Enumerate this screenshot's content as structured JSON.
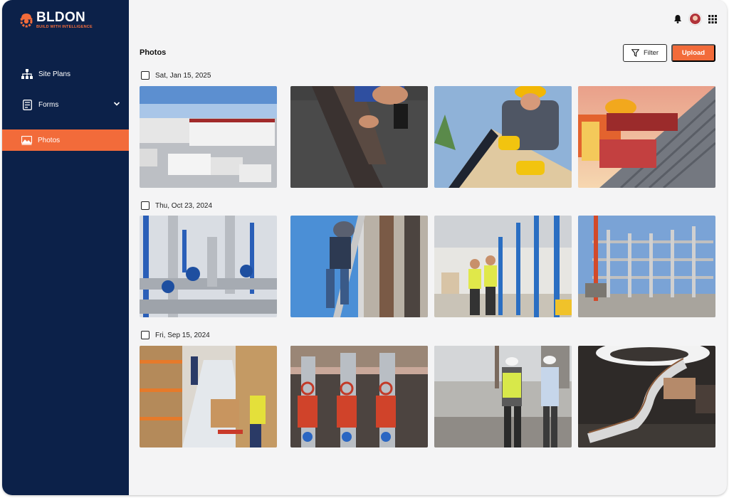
{
  "app": {
    "name": "BLDON",
    "tagline": "BUILD WITH INTELLIGENCE"
  },
  "colors": {
    "sidebar": "#0c2149",
    "accent": "#f26b3a",
    "background": "#f4f4f5"
  },
  "sidebar": {
    "items": [
      {
        "label": "Site Plans",
        "icon": "sitemap-icon"
      },
      {
        "label": "Forms",
        "icon": "form-icon"
      },
      {
        "label": "Photos",
        "icon": "photo-icon",
        "active": true
      }
    ]
  },
  "header": {
    "icons": [
      "bell-icon",
      "user-avatar",
      "grid-apps-icon"
    ]
  },
  "main": {
    "title": "Photos",
    "filter_label": "Filter",
    "upload_label": "Upload",
    "groups": [
      {
        "date": "Sat, Jan 15, 2025",
        "photos": [
          "industrial-facility",
          "floor-installation",
          "roof-carpentry",
          "roof-worker"
        ]
      },
      {
        "date": "Thu, Oct 23, 2024",
        "photos": [
          "pipe-system",
          "ladder-worker",
          "warehouse-inspection",
          "concrete-frame"
        ]
      },
      {
        "date": "Fri, Sep 15, 2024",
        "photos": [
          "warehouse-shelves",
          "valve-piping",
          "site-supervisors",
          "spiral-staircase"
        ]
      }
    ]
  }
}
